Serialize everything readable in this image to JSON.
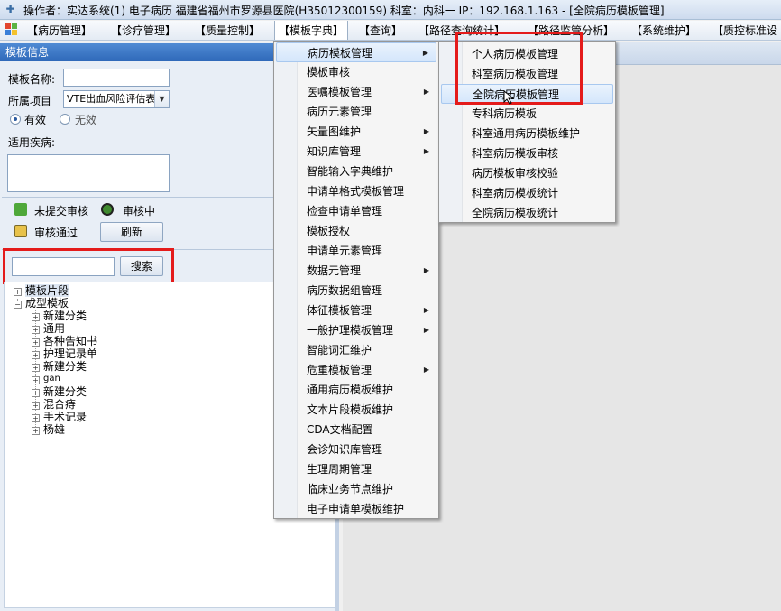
{
  "window": {
    "title": "操作者：实达系统(1) 电子病历  福建省福州市罗源县医院(H35012300159)  科室：内科一  IP：192.168.1.163 - [全院病历模板管理]"
  },
  "menubar": {
    "items": [
      {
        "label": "【病历管理】"
      },
      {
        "label": "【诊疗管理】"
      },
      {
        "label": "【质量控制】"
      },
      {
        "label": "【模板字典】"
      },
      {
        "label": "【查询】"
      },
      {
        "label": "【路径查询统计】"
      },
      {
        "label": "【路径监管分析】"
      },
      {
        "label": "【系统维护】"
      },
      {
        "label": "【质控标准设"
      }
    ]
  },
  "panel": {
    "header": "模板信息",
    "name_label": "模板名称:",
    "name_value": "",
    "project_label": "所属项目",
    "project_value": "VTE出血风险评估表",
    "radio_valid": "有效",
    "radio_invalid": "无效",
    "disease_label": "适用疾病:",
    "status_unsubmitted": "未提交审核",
    "status_reviewing": "审核中",
    "status_approved": "审核通过",
    "refresh_button": "刷新",
    "search_value": "",
    "search_button": "搜索"
  },
  "tree": {
    "root1": "模板片段",
    "root2": "成型模板",
    "children": [
      "新建分类",
      "通用",
      "各种告知书",
      "护理记录单",
      "新建分类",
      "gan",
      "新建分类",
      "混合痔",
      "手术记录",
      "杨雄"
    ]
  },
  "dropdown": {
    "items": [
      {
        "label": "病历模板管理",
        "sub": true
      },
      {
        "label": "模板审核",
        "sub": false
      },
      {
        "label": "医嘱模板管理",
        "sub": true
      },
      {
        "label": "病历元素管理",
        "sub": false
      },
      {
        "label": "矢量图维护",
        "sub": true
      },
      {
        "label": "知识库管理",
        "sub": true
      },
      {
        "label": "智能输入字典维护",
        "sub": false
      },
      {
        "label": "申请单格式模板管理",
        "sub": false
      },
      {
        "label": "检查申请单管理",
        "sub": false
      },
      {
        "label": "模板授权",
        "sub": false
      },
      {
        "label": "申请单元素管理",
        "sub": false
      },
      {
        "label": "数据元管理",
        "sub": true
      },
      {
        "label": "病历数据组管理",
        "sub": false
      },
      {
        "label": "体征模板管理",
        "sub": true
      },
      {
        "label": "一般护理模板管理",
        "sub": true
      },
      {
        "label": "智能词汇维护",
        "sub": false
      },
      {
        "label": "危重模板管理",
        "sub": true
      },
      {
        "label": "通用病历模板维护",
        "sub": false
      },
      {
        "label": "文本片段模板维护",
        "sub": false
      },
      {
        "label": "CDA文档配置",
        "sub": false
      },
      {
        "label": "会诊知识库管理",
        "sub": false
      },
      {
        "label": "生理周期管理",
        "sub": false
      },
      {
        "label": "临床业务节点维护",
        "sub": false
      },
      {
        "label": "电子申请单模板维护",
        "sub": false
      }
    ]
  },
  "submenu": {
    "items": [
      {
        "label": "个人病历模板管理"
      },
      {
        "label": "科室病历模板管理"
      },
      {
        "label": "全院病历模板管理"
      },
      {
        "label": "专科病历模板"
      },
      {
        "label": "科室通用病历模板维护"
      },
      {
        "label": "科室病历模板审核"
      },
      {
        "label": "病历模板审核校验"
      },
      {
        "label": "科室病历模板统计"
      },
      {
        "label": "全院病历模板统计"
      }
    ]
  },
  "colors": {
    "highlight_box": "#e41b1b",
    "panel_header": "#2f69b9"
  }
}
